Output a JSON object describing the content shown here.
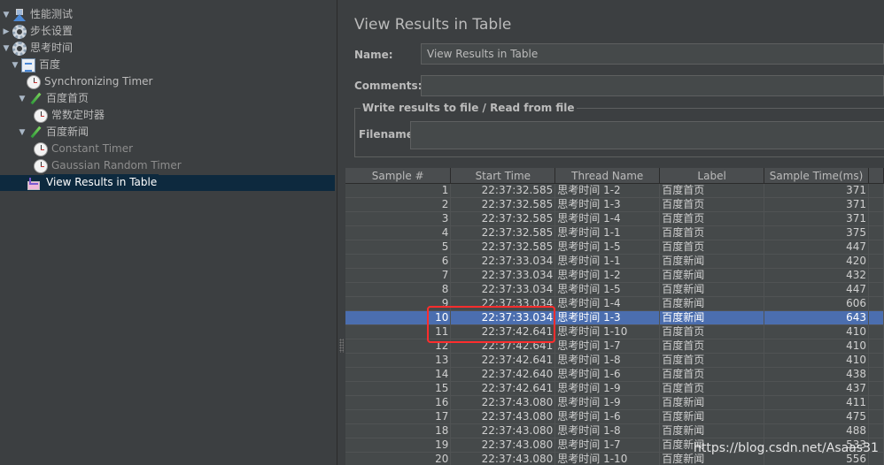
{
  "tree": {
    "items": [
      {
        "label": "性能测试",
        "icon": "flask-icon",
        "toggle": "▼",
        "depth": 0,
        "dim": false,
        "selected": false
      },
      {
        "label": "步长设置",
        "icon": "gear-icon",
        "toggle": "▶",
        "depth": 0,
        "dim": false,
        "selected": false
      },
      {
        "label": "思考时间",
        "icon": "gear-icon",
        "toggle": "▼",
        "depth": 0,
        "dim": false,
        "selected": false
      },
      {
        "label": "百度",
        "icon": "request-icon",
        "toggle": "▼",
        "depth": 1,
        "dim": false,
        "selected": false
      },
      {
        "label": "Synchronizing Timer",
        "icon": "timer-icon",
        "toggle": "",
        "depth": 2,
        "dim": false,
        "selected": false
      },
      {
        "label": "百度首页",
        "icon": "pipette-icon",
        "toggle": "▼",
        "depth": 2,
        "dim": false,
        "selected": false
      },
      {
        "label": "常数定时器",
        "icon": "timer-icon",
        "toggle": "",
        "depth": 3,
        "dim": false,
        "selected": false
      },
      {
        "label": "百度新闻",
        "icon": "pipette-icon",
        "toggle": "▼",
        "depth": 2,
        "dim": false,
        "selected": false
      },
      {
        "label": "Constant Timer",
        "icon": "timer-icon",
        "toggle": "",
        "depth": 3,
        "dim": true,
        "selected": false
      },
      {
        "label": "Gaussian Random Timer",
        "icon": "timer-icon",
        "toggle": "",
        "depth": 3,
        "dim": true,
        "selected": false
      },
      {
        "label": "View Results in Table",
        "icon": "results-icon",
        "toggle": "",
        "depth": 2,
        "dim": false,
        "selected": true
      }
    ]
  },
  "panel": {
    "title": "View Results in Table",
    "name_label": "Name:",
    "name_value": "View Results in Table",
    "comments_label": "Comments:",
    "comments_value": "",
    "file_section_title": "Write results to file / Read from file",
    "filename_label": "Filename",
    "filename_value": ""
  },
  "table": {
    "columns": [
      "Sample #",
      "Start Time",
      "Thread Name",
      "Label",
      "Sample Time(ms)"
    ],
    "selected_row": 9,
    "rows": [
      [
        "1",
        "22:37:32.585",
        "思考时间 1-2",
        "百度首页",
        "371"
      ],
      [
        "2",
        "22:37:32.585",
        "思考时间 1-3",
        "百度首页",
        "371"
      ],
      [
        "3",
        "22:37:32.585",
        "思考时间 1-4",
        "百度首页",
        "371"
      ],
      [
        "4",
        "22:37:32.585",
        "思考时间 1-1",
        "百度首页",
        "375"
      ],
      [
        "5",
        "22:37:32.585",
        "思考时间 1-5",
        "百度首页",
        "447"
      ],
      [
        "6",
        "22:37:33.034",
        "思考时间 1-1",
        "百度新闻",
        "420"
      ],
      [
        "7",
        "22:37:33.034",
        "思考时间 1-2",
        "百度新闻",
        "432"
      ],
      [
        "8",
        "22:37:33.034",
        "思考时间 1-5",
        "百度新闻",
        "447"
      ],
      [
        "9",
        "22:37:33.034",
        "思考时间 1-4",
        "百度新闻",
        "606"
      ],
      [
        "10",
        "22:37:33.034",
        "思考时间 1-3",
        "百度新闻",
        "643"
      ],
      [
        "11",
        "22:37:42.641",
        "思考时间 1-10",
        "百度首页",
        "410"
      ],
      [
        "12",
        "22:37:42.641",
        "思考时间 1-7",
        "百度首页",
        "410"
      ],
      [
        "13",
        "22:37:42.641",
        "思考时间 1-8",
        "百度首页",
        "410"
      ],
      [
        "14",
        "22:37:42.640",
        "思考时间 1-6",
        "百度首页",
        "438"
      ],
      [
        "15",
        "22:37:42.641",
        "思考时间 1-9",
        "百度首页",
        "437"
      ],
      [
        "16",
        "22:37:43.080",
        "思考时间 1-9",
        "百度新闻",
        "411"
      ],
      [
        "17",
        "22:37:43.080",
        "思考时间 1-6",
        "百度新闻",
        "475"
      ],
      [
        "18",
        "22:37:43.080",
        "思考时间 1-8",
        "百度新闻",
        "488"
      ],
      [
        "19",
        "22:37:43.080",
        "思考时间 1-7",
        "百度新闻",
        "533"
      ],
      [
        "20",
        "22:37:43.080",
        "思考时间 1-10",
        "百度新闻",
        "556"
      ]
    ]
  },
  "watermark": "https://blog.csdn.net/Asaas31",
  "colors": {
    "selection": "#4b6eaf",
    "highlight_box": "#ff2d2d",
    "tree_selection": "#0d293e"
  }
}
